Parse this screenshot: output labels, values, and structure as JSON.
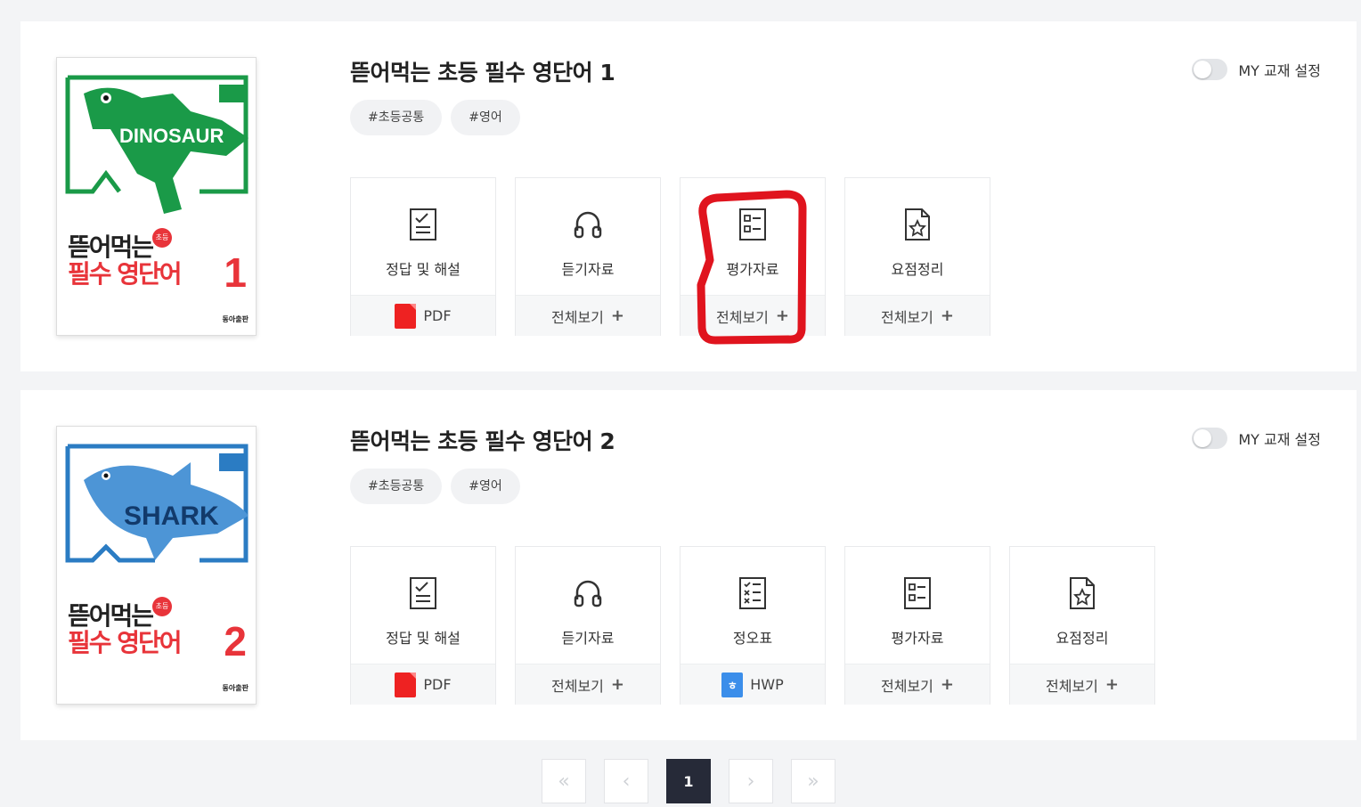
{
  "books": [
    {
      "title": "뜯어먹는 초등 필수 영단어 1",
      "tags": [
        "#초등공통",
        "#영어"
      ],
      "my_setting_label": "MY 교재 설정",
      "cover": {
        "mascot_text": "DINOSAUR",
        "badge": "초등",
        "line1": "뜯어먹는",
        "line2": "필수 영단어",
        "number": "1",
        "accent": "#1a9a48",
        "publisher": "동아출판"
      },
      "resources": [
        {
          "label": "정답 및 해설",
          "icon": "checklist-doc-icon",
          "action": "PDF",
          "action_type": "pdf"
        },
        {
          "label": "듣기자료",
          "icon": "headphones-icon",
          "action": "전체보기",
          "action_type": "plus"
        },
        {
          "label": "평가자료",
          "icon": "test-sheet-icon",
          "action": "전체보기",
          "action_type": "plus"
        },
        {
          "label": "요점정리",
          "icon": "star-doc-icon",
          "action": "전체보기",
          "action_type": "plus"
        }
      ]
    },
    {
      "title": "뜯어먹는 초등 필수 영단어 2",
      "tags": [
        "#초등공통",
        "#영어"
      ],
      "my_setting_label": "MY 교재 설정",
      "cover": {
        "mascot_text": "SHARK",
        "badge": "초등",
        "line1": "뜯어먹는",
        "line2": "필수 영단어",
        "number": "2",
        "accent": "#2b7cc3",
        "publisher": "동아출판"
      },
      "resources": [
        {
          "label": "정답 및 해설",
          "icon": "checklist-doc-icon",
          "action": "PDF",
          "action_type": "pdf"
        },
        {
          "label": "듣기자료",
          "icon": "headphones-icon",
          "action": "전체보기",
          "action_type": "plus"
        },
        {
          "label": "정오표",
          "icon": "errata-icon",
          "action": "HWP",
          "action_type": "hwp"
        },
        {
          "label": "평가자료",
          "icon": "test-sheet-icon",
          "action": "전체보기",
          "action_type": "plus"
        },
        {
          "label": "요점정리",
          "icon": "star-doc-icon",
          "action": "전체보기",
          "action_type": "plus"
        }
      ]
    }
  ],
  "pagination": {
    "first": "«",
    "prev": "‹",
    "current": "1",
    "next": "›",
    "last": "»"
  },
  "hwp_glyph": "ㅎ",
  "plus_glyph": "+",
  "annotation_color": "#e0141e"
}
